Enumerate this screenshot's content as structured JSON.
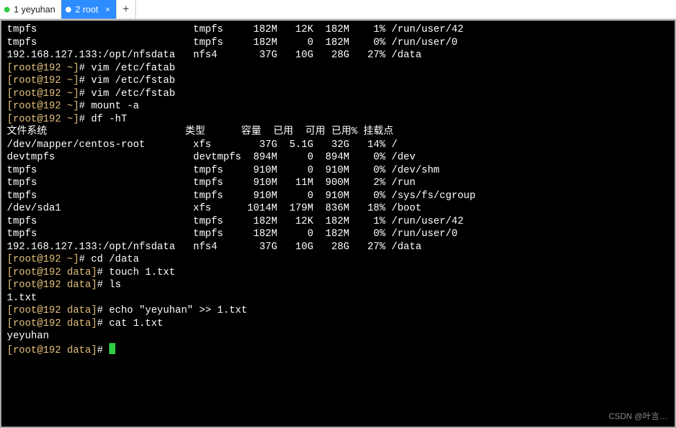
{
  "tabs": [
    {
      "label": "1 yeyuhan",
      "active": false
    },
    {
      "label": "2 root",
      "active": true
    }
  ],
  "newtab": "+",
  "close_glyph": "×",
  "watermark": "CSDN @叶言…",
  "pre_lines": [
    "tmpfs                          tmpfs     182M   12K  182M    1% /run/user/42",
    "tmpfs                          tmpfs     182M     0  182M    0% /run/user/0",
    "192.168.127.133:/opt/nfsdata   nfs4       37G   10G   28G   27% /data"
  ],
  "cmds1": [
    "vim /etc/fatab",
    "vim /etc/fstab",
    "vim /etc/fstab",
    "mount -a",
    "df -hT"
  ],
  "df_header": "文件系统                       类型      容量  已用  可用 已用% 挂载点",
  "df_rows": [
    "/dev/mapper/centos-root        xfs        37G  5.1G   32G   14% /",
    "devtmpfs                       devtmpfs  894M     0  894M    0% /dev",
    "tmpfs                          tmpfs     910M     0  910M    0% /dev/shm",
    "tmpfs                          tmpfs     910M   11M  900M    2% /run",
    "tmpfs                          tmpfs     910M     0  910M    0% /sys/fs/cgroup",
    "/dev/sda1                      xfs      1014M  179M  836M   18% /boot",
    "tmpfs                          tmpfs     182M   12K  182M    1% /run/user/42",
    "tmpfs                          tmpfs     182M     0  182M    0% /run/user/0",
    "192.168.127.133:/opt/nfsdata   nfs4       37G   10G   28G   27% /data"
  ],
  "cmd_cd": "cd /data",
  "cmds_data": [
    "touch 1.txt",
    "ls"
  ],
  "ls_output": "1.txt",
  "cmd_echo": "echo \"yeyuhan\" >> 1.txt",
  "cmd_cat": "cat 1.txt",
  "cat_output": "yeyuhan",
  "prompts": {
    "home_open": "[root@192 ~]",
    "home_close": "# ",
    "data_open": "[root@192 data]",
    "data_close": "# "
  },
  "chart_data": {
    "type": "table",
    "title": "df -hT",
    "columns": [
      "文件系统",
      "类型",
      "容量",
      "已用",
      "可用",
      "已用%",
      "挂载点"
    ],
    "rows": [
      [
        "/dev/mapper/centos-root",
        "xfs",
        "37G",
        "5.1G",
        "32G",
        "14%",
        "/"
      ],
      [
        "devtmpfs",
        "devtmpfs",
        "894M",
        "0",
        "894M",
        "0%",
        "/dev"
      ],
      [
        "tmpfs",
        "tmpfs",
        "910M",
        "0",
        "910M",
        "0%",
        "/dev/shm"
      ],
      [
        "tmpfs",
        "tmpfs",
        "910M",
        "11M",
        "900M",
        "2%",
        "/run"
      ],
      [
        "tmpfs",
        "tmpfs",
        "910M",
        "0",
        "910M",
        "0%",
        "/sys/fs/cgroup"
      ],
      [
        "/dev/sda1",
        "xfs",
        "1014M",
        "179M",
        "836M",
        "18%",
        "/boot"
      ],
      [
        "tmpfs",
        "tmpfs",
        "182M",
        "12K",
        "182M",
        "1%",
        "/run/user/42"
      ],
      [
        "tmpfs",
        "tmpfs",
        "182M",
        "0",
        "182M",
        "0%",
        "/run/user/0"
      ],
      [
        "192.168.127.133:/opt/nfsdata",
        "nfs4",
        "37G",
        "10G",
        "28G",
        "27%",
        "/data"
      ]
    ]
  }
}
